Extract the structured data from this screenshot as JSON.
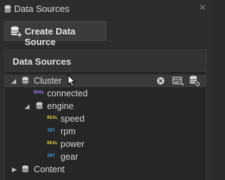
{
  "window": {
    "title": "Data Sources",
    "title_icon": "database-icon",
    "close_icon": "close-icon"
  },
  "toolbar": {
    "create_label": "Create Data Source",
    "create_icon": "database-add-icon"
  },
  "panel": {
    "header": "Data Sources",
    "tree": [
      {
        "label": "Cluster",
        "icon": "database-icon",
        "expanded": true,
        "selected": true,
        "level": 0
      },
      {
        "label": "connected",
        "type": "BOOL",
        "level": 1
      },
      {
        "label": "engine",
        "icon": "database-icon",
        "expanded": true,
        "level": 1
      },
      {
        "label": "speed",
        "type": "REAL",
        "level": 2
      },
      {
        "label": "rpm",
        "type": "INT",
        "level": 2
      },
      {
        "label": "power",
        "type": "REAL",
        "level": 2
      },
      {
        "label": "gear",
        "type": "INT",
        "level": 2
      },
      {
        "label": "Content",
        "icon": "database-icon",
        "expanded": false,
        "level": 0
      }
    ],
    "row_tools": [
      "clear-icon",
      "data-grid-icon",
      "database-refresh-icon"
    ]
  },
  "colors": {
    "bool": "#a678ff",
    "real": "#e8d33b",
    "int": "#3aa8f0",
    "background": "#2d2d2d"
  }
}
